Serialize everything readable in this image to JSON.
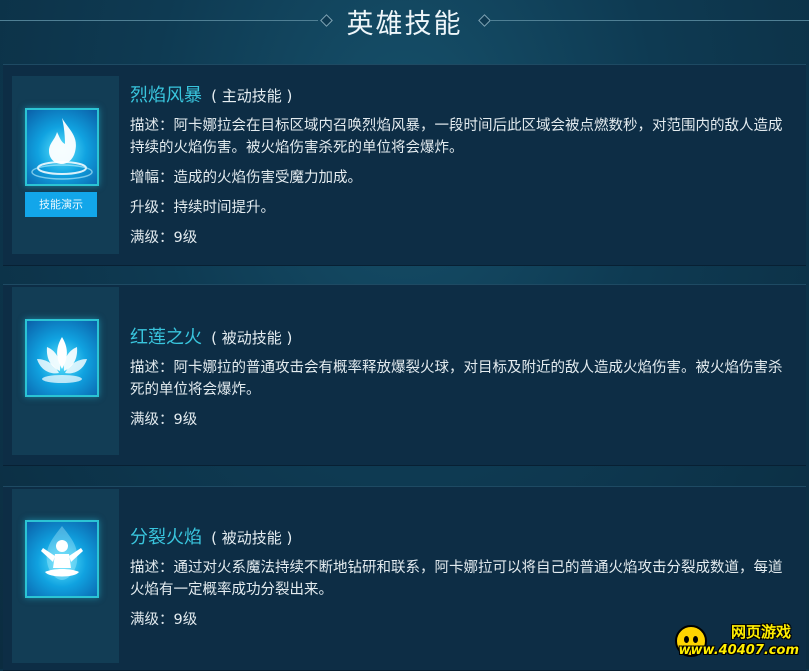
{
  "header": {
    "title": "英雄技能"
  },
  "skills": [
    {
      "name": "烈焰风暴",
      "type": "( 主动技能 )",
      "icon": "flame-storm-icon",
      "demo_label": "技能演示",
      "lines": [
        "描述：阿卡娜拉会在目标区域内召唤烈焰风暴，一段时间后此区域会被点燃数秒，对范围内的敌人造成持续的火焰伤害。被火焰伤害杀死的单位将会爆炸。",
        "增幅：造成的火焰伤害受魔力加成。",
        "升级：持续时间提升。",
        "满级：9级"
      ]
    },
    {
      "name": "红莲之火",
      "type": "( 被动技能 )",
      "icon": "red-lotus-icon",
      "lines": [
        "描述：阿卡娜拉的普通攻击会有概率释放爆裂火球，对目标及附近的敌人造成火焰伤害。被火焰伤害杀死的单位将会爆炸。",
        "满级：9级"
      ]
    },
    {
      "name": "分裂火焰",
      "type": "( 被动技能 )",
      "icon": "split-flame-icon",
      "lines": [
        "描述：通过对火系魔法持续不断地钻研和联系，阿卡娜拉可以将自己的普通火焰攻击分裂成数道，每道火焰有一定概率成功分裂出来。",
        "满级：9级"
      ]
    }
  ],
  "watermark": {
    "brand": "网页游戏",
    "url": "www.40407.com"
  }
}
